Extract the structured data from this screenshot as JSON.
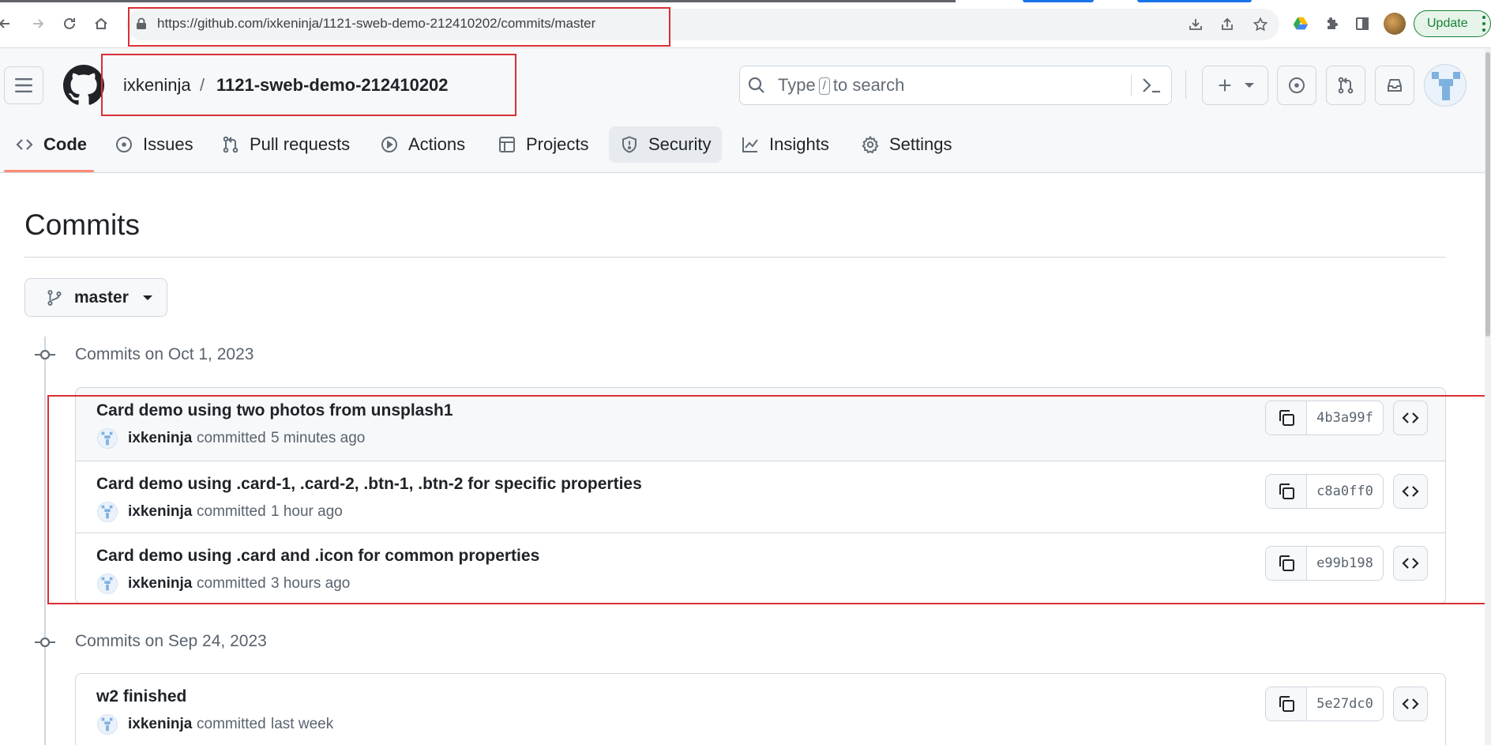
{
  "browser": {
    "url": "https://github.com/ixkeninja/1121-sweb-demo-212410202/commits/master",
    "update_label": "Update"
  },
  "header": {
    "owner": "ixkeninja",
    "separator": "/",
    "repo": "1121-sweb-demo-212410202",
    "search_before": "Type",
    "search_key": "/",
    "search_after": "to search"
  },
  "tabs": [
    {
      "label": "Code",
      "icon": "code-icon",
      "selected": true
    },
    {
      "label": "Issues",
      "icon": "issue-opened-icon"
    },
    {
      "label": "Pull requests",
      "icon": "git-pull-request-icon"
    },
    {
      "label": "Actions",
      "icon": "play-icon"
    },
    {
      "label": "Projects",
      "icon": "table-icon"
    },
    {
      "label": "Security",
      "icon": "shield-icon"
    },
    {
      "label": "Insights",
      "icon": "graph-icon"
    },
    {
      "label": "Settings",
      "icon": "gear-icon"
    }
  ],
  "page": {
    "title": "Commits",
    "branch": "master"
  },
  "groups": [
    {
      "heading": "Commits on Oct 1, 2023",
      "commits": [
        {
          "message": "Card demo using two photos from unsplash1",
          "author": "ixkeninja",
          "verb": "committed",
          "time": "5 minutes ago",
          "sha": "4b3a99f"
        },
        {
          "message": "Card demo using .card-1, .card-2, .btn-1, .btn-2 for specific properties",
          "author": "ixkeninja",
          "verb": "committed",
          "time": "1 hour ago",
          "sha": "c8a0ff0"
        },
        {
          "message": "Card demo using .card and .icon for common properties",
          "author": "ixkeninja",
          "verb": "committed",
          "time": "3 hours ago",
          "sha": "e99b198"
        }
      ]
    },
    {
      "heading": "Commits on Sep 24, 2023",
      "commits": [
        {
          "message": "w2 finished",
          "author": "ixkeninja",
          "verb": "committed",
          "time": "last week",
          "sha": "5e27dc0"
        }
      ]
    }
  ],
  "colors": {
    "accent_underline": "#fd8c73",
    "annotation_red": "#d93036",
    "update_green": "#188038"
  }
}
